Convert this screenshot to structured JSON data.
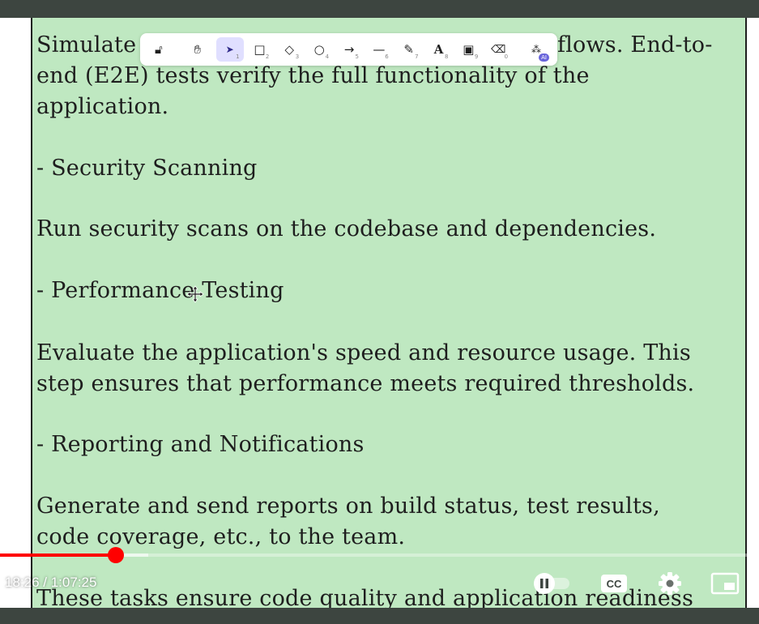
{
  "notes": {
    "line1": "Simulate",
    "line1_tail": "flows. End-to-",
    "line2": "end (E2E) tests verify the full functionality of the",
    "line3": "application.",
    "heading_security": "- Security Scanning",
    "security_text": "Run security scans on the codebase and dependencies.",
    "heading_performance": "- Performance Testing",
    "performance_text_1": "Evaluate the application's speed and resource usage. This",
    "performance_text_2": "step ensures that performance meets required thresholds.",
    "heading_reporting": "- Reporting and Notifications",
    "reporting_text_1": "Generate and send reports on build status, test results,",
    "reporting_text_2": "code coverage, etc., to the team.",
    "closing_text": "These tasks ensure code quality and application readiness"
  },
  "toolbar": {
    "tools": [
      {
        "name": "lock",
        "icon": "lock-icon",
        "glyph": "🔓︎",
        "num": ""
      },
      {
        "name": "hand",
        "icon": "hand-icon",
        "glyph": "✋︎",
        "num": ""
      },
      {
        "name": "select",
        "icon": "pointer-icon",
        "glyph": "➤",
        "num": "1",
        "active": true
      },
      {
        "name": "rectangle",
        "icon": "rectangle-icon",
        "glyph": "□",
        "num": "2"
      },
      {
        "name": "diamond",
        "icon": "diamond-icon",
        "glyph": "◇",
        "num": "3"
      },
      {
        "name": "ellipse",
        "icon": "ellipse-icon",
        "glyph": "○",
        "num": "4"
      },
      {
        "name": "arrow",
        "icon": "arrow-icon",
        "glyph": "→",
        "num": "5"
      },
      {
        "name": "line",
        "icon": "line-icon",
        "glyph": "—",
        "num": "6"
      },
      {
        "name": "draw",
        "icon": "pencil-icon",
        "glyph": "✎",
        "num": "7"
      },
      {
        "name": "text",
        "icon": "text-icon",
        "glyph": "A",
        "num": "8"
      },
      {
        "name": "image",
        "icon": "image-icon",
        "glyph": "▣",
        "num": "9"
      },
      {
        "name": "eraser",
        "icon": "eraser-icon",
        "glyph": "⌫",
        "num": "0"
      },
      {
        "name": "more",
        "icon": "shapes-icon",
        "glyph": "⁂",
        "num": ""
      }
    ],
    "ai_badge": "AI"
  },
  "player": {
    "time": "18:26 / 1:07:25",
    "progress_fraction": 0.2734,
    "cc_label": "CC",
    "accent": "#ff0000"
  }
}
